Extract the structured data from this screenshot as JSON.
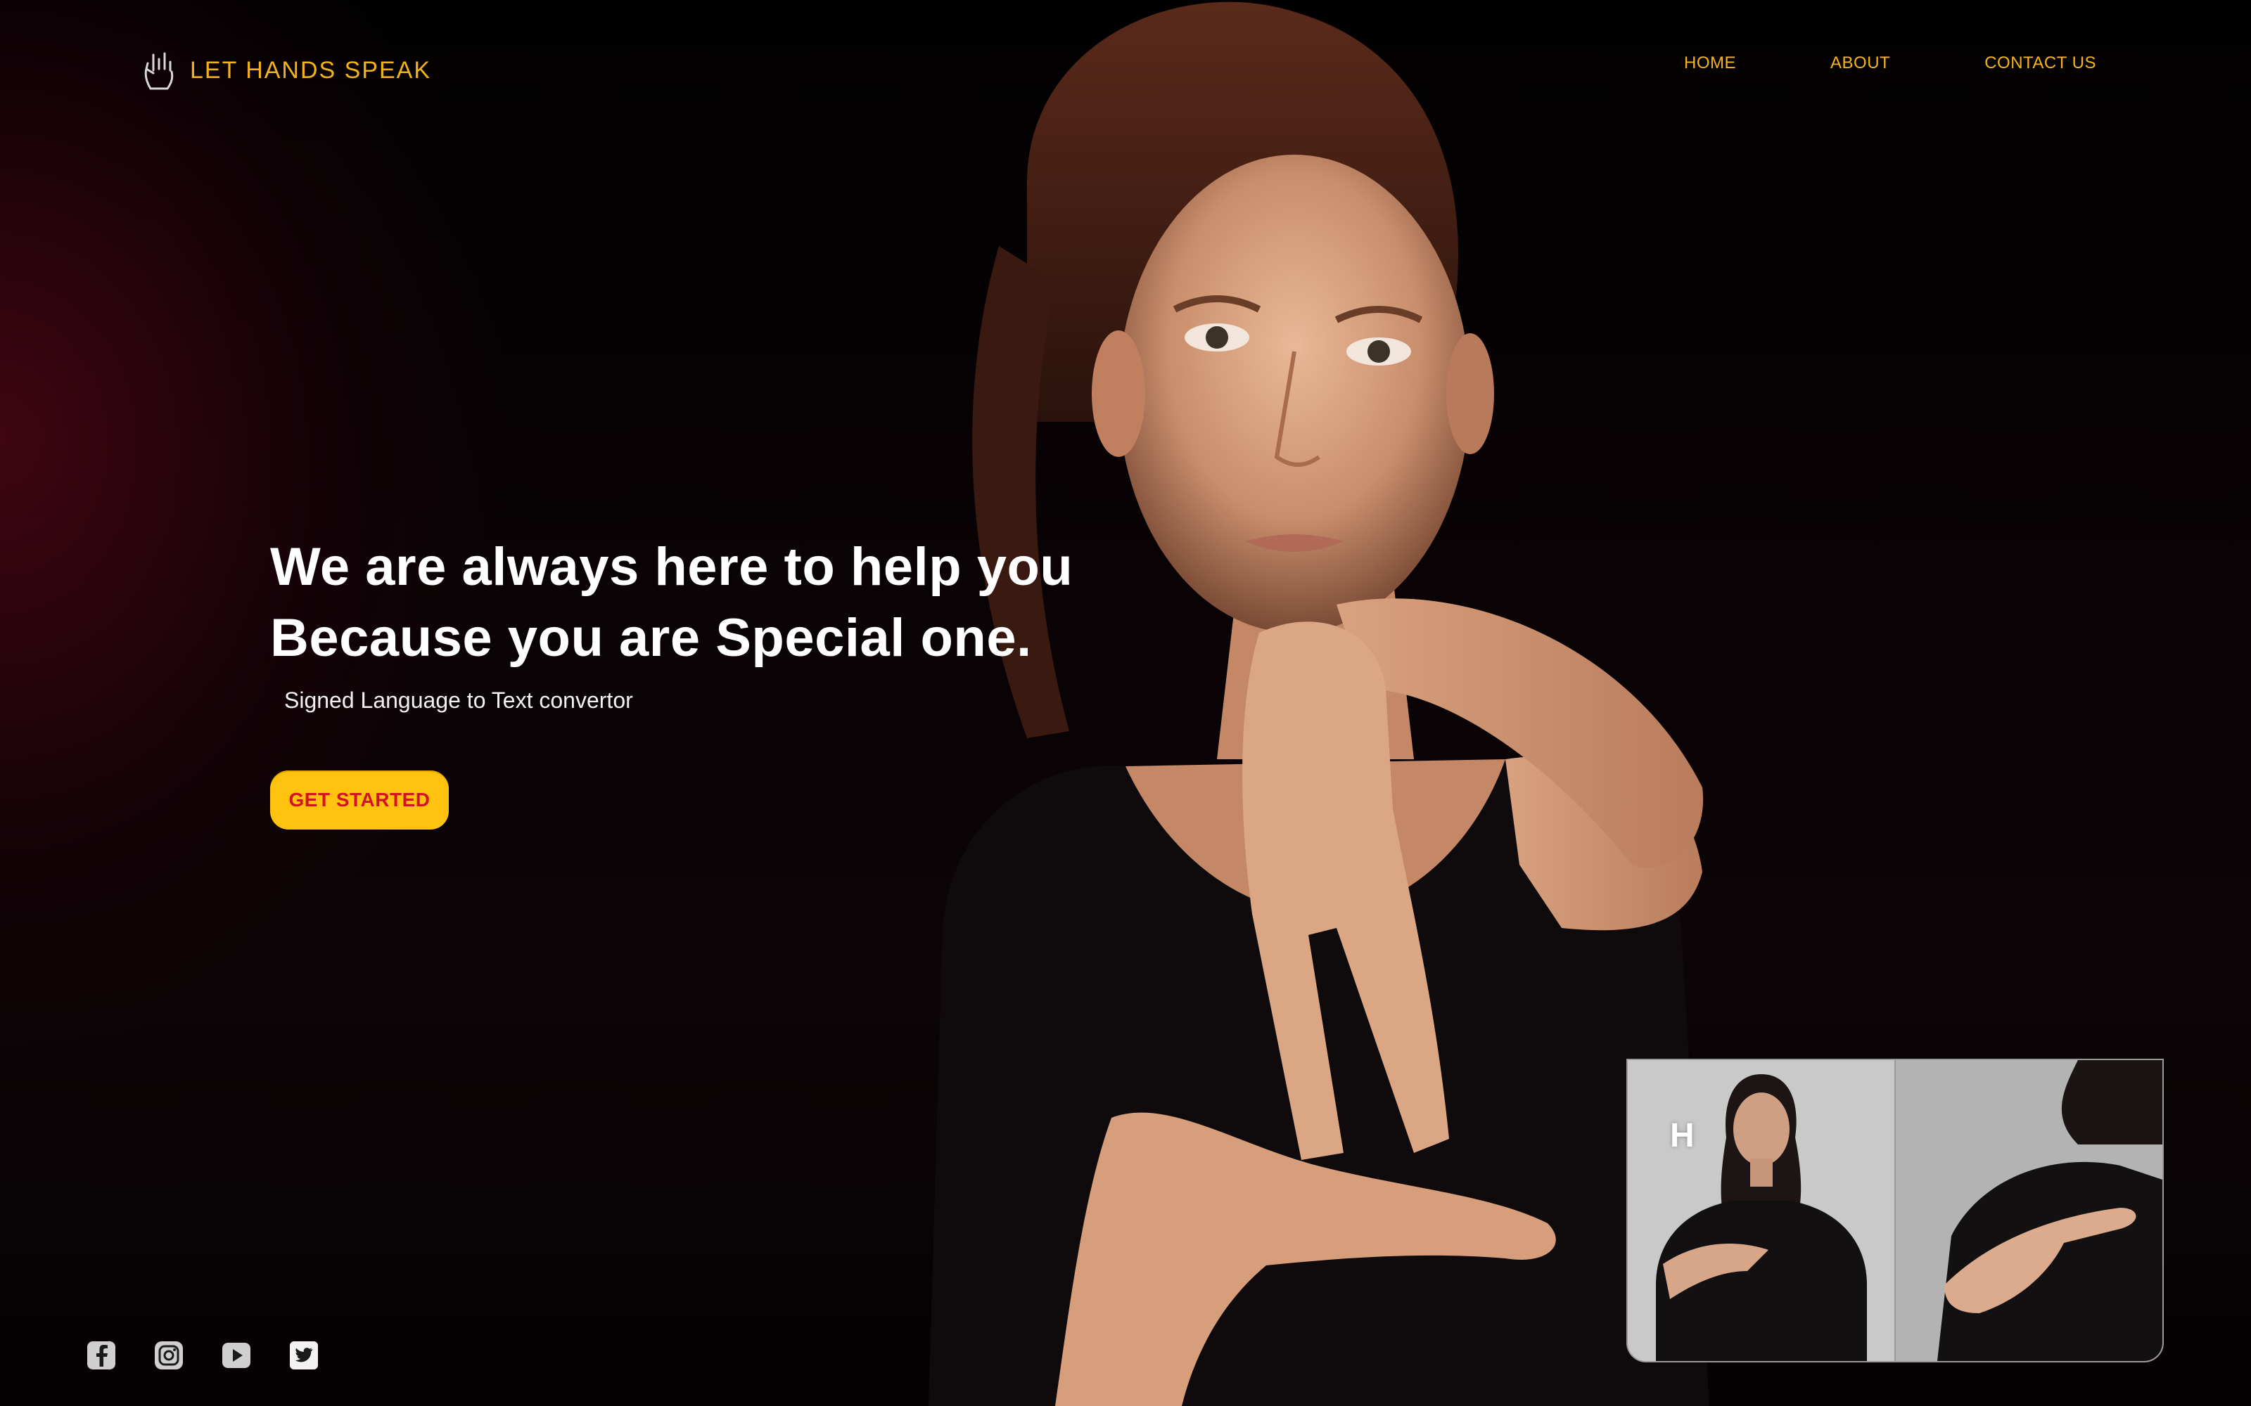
{
  "brand": {
    "name": "LET HANDS SPEAK",
    "icon": "hand-sign-icon",
    "accent_color": "#f5b51a"
  },
  "nav": {
    "items": [
      {
        "label": "HOME"
      },
      {
        "label": "ABOUT"
      },
      {
        "label": "CONTACT US"
      }
    ]
  },
  "hero": {
    "title_line1": "We are always here to help you",
    "title_line2": "Because you are Special one.",
    "subtitle": "Signed Language to Text convertor",
    "cta_label": "GET STARTED",
    "cta_color": "#ffc20e",
    "cta_text_color": "#d21324"
  },
  "video_preview": {
    "letter": "H"
  },
  "social": {
    "icons": [
      "facebook-icon",
      "instagram-icon",
      "youtube-icon",
      "twitter-icon"
    ]
  }
}
